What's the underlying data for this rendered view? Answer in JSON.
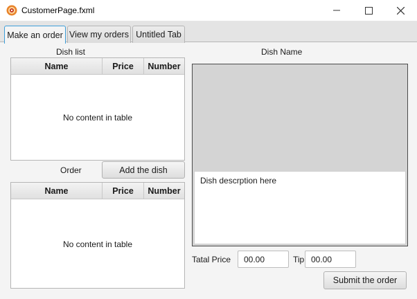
{
  "window": {
    "title": "CustomerPage.fxml",
    "icon": "fxml-app-icon",
    "controls": [
      "minimize-icon",
      "maximize-icon",
      "close-icon"
    ]
  },
  "tabs": [
    {
      "label": "Make an order",
      "active": true
    },
    {
      "label": "View my orders",
      "active": false
    },
    {
      "label": "Untitled Tab",
      "active": false
    }
  ],
  "dish_list": {
    "title": "Dish list",
    "columns": [
      "Name",
      "Price",
      "Number"
    ],
    "rows": [],
    "empty_text": "No content in table"
  },
  "order": {
    "title": "Order",
    "add_button": "Add the dish",
    "columns": [
      "Name",
      "Price",
      "Number"
    ],
    "rows": [],
    "empty_text": "No content in table"
  },
  "dish": {
    "name": "Dish Name",
    "description": "Dish descrption here"
  },
  "totals": {
    "total_label": "Tatal Price",
    "total_value": "00.00",
    "tip_label": "Tip",
    "tip_value": "00.00",
    "submit_button": "Submit the order"
  },
  "colors": {
    "focus_accent": "#3d9ed9",
    "app_icon_orange": "#e8832a"
  }
}
